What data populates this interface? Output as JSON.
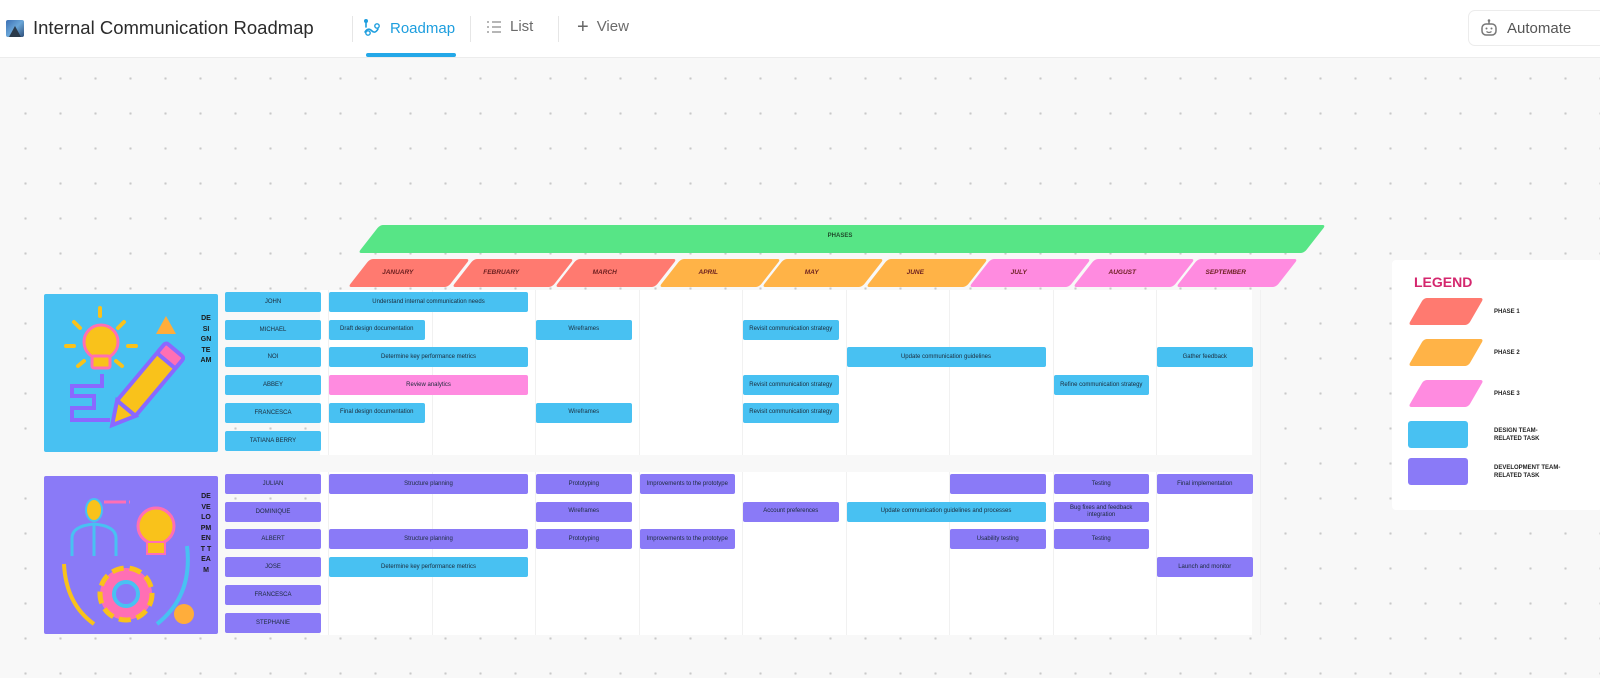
{
  "header": {
    "title": "Internal Communication Roadmap",
    "tabs": [
      {
        "label": "Roadmap",
        "icon": "roadmap-icon",
        "active": true
      },
      {
        "label": "List",
        "icon": "list-icon",
        "active": false
      },
      {
        "label": "View",
        "icon": "plus-icon",
        "active": false
      }
    ],
    "automate_label": "Automate"
  },
  "roadmap": {
    "phases_label": "PHASES",
    "months": [
      {
        "label": "JANUARY",
        "phase": 1
      },
      {
        "label": "FEBRUARY",
        "phase": 1
      },
      {
        "label": "MARCH",
        "phase": 1
      },
      {
        "label": "APRIL",
        "phase": 2
      },
      {
        "label": "MAY",
        "phase": 2
      },
      {
        "label": "JUNE",
        "phase": 2
      },
      {
        "label": "JULY",
        "phase": 3
      },
      {
        "label": "AUGUST",
        "phase": 3
      },
      {
        "label": "SEPTEMBER",
        "phase": 3
      }
    ],
    "colors": {
      "phase1": "#ff7a70",
      "phase2": "#ffb347",
      "phase3": "#ff8be0",
      "phases_header": "#57e586",
      "design_task": "#48c1f2",
      "dev_task": "#8a7af7",
      "legend_title": "#d4276e"
    },
    "teams": [
      {
        "name": "DESIGN TEAM",
        "members": [
          "John",
          "Michael",
          "Noi",
          "Abbey",
          "Francesca",
          "Tatiana Berry"
        ],
        "tasks": [
          {
            "member": 0,
            "start": 0,
            "span": 2,
            "type": "design",
            "label": "Understand internal communication needs"
          },
          {
            "member": 1,
            "start": 0,
            "span": 1,
            "type": "design",
            "label": "Draft design documentation"
          },
          {
            "member": 1,
            "start": 2,
            "span": 1,
            "type": "design",
            "label": "Wireframes"
          },
          {
            "member": 1,
            "start": 4,
            "span": 1,
            "type": "design",
            "label": "Revisit communication strategy"
          },
          {
            "member": 2,
            "start": 0,
            "span": 2,
            "type": "design",
            "label": "Determine key performance metrics"
          },
          {
            "member": 2,
            "start": 5,
            "span": 2,
            "type": "design",
            "label": "Update communication guidelines"
          },
          {
            "member": 2,
            "start": 8,
            "span": 1,
            "type": "design",
            "label": "Gather feedback"
          },
          {
            "member": 3,
            "start": 0,
            "span": 2,
            "type": "pink",
            "label": "Review analytics"
          },
          {
            "member": 3,
            "start": 4,
            "span": 1,
            "type": "design",
            "label": "Revisit communication strategy"
          },
          {
            "member": 3,
            "start": 7,
            "span": 1,
            "type": "design",
            "label": "Refine communication strategy"
          },
          {
            "member": 4,
            "start": 0,
            "span": 1,
            "type": "design",
            "label": "Final design documentation"
          },
          {
            "member": 4,
            "start": 2,
            "span": 1,
            "type": "design",
            "label": "Wireframes"
          },
          {
            "member": 4,
            "start": 4,
            "span": 1,
            "type": "design",
            "label": "Revisit communication strategy"
          }
        ]
      },
      {
        "name": "DEVELOPMENT TEAM",
        "members": [
          "Julian",
          "Dominique",
          "Albert",
          "Jose",
          "Francesca",
          "Stephanie"
        ],
        "tasks": [
          {
            "member": 0,
            "start": 0,
            "span": 2,
            "type": "dev",
            "label": "Structure planning"
          },
          {
            "member": 0,
            "start": 2,
            "span": 1,
            "type": "dev",
            "label": "Prototyping"
          },
          {
            "member": 0,
            "start": 3,
            "span": 1,
            "type": "dev",
            "label": "Improvements to the prototype"
          },
          {
            "member": 0,
            "start": 6,
            "span": 1,
            "type": "dev",
            "label": ""
          },
          {
            "member": 0,
            "start": 7,
            "span": 1,
            "type": "dev",
            "label": "Testing"
          },
          {
            "member": 0,
            "start": 8,
            "span": 1,
            "type": "dev",
            "label": "Final implementation"
          },
          {
            "member": 1,
            "start": 2,
            "span": 1,
            "type": "dev",
            "label": "Wireframes"
          },
          {
            "member": 1,
            "start": 4,
            "span": 1,
            "type": "dev",
            "label": "Account preferences"
          },
          {
            "member": 1,
            "start": 5,
            "span": 2,
            "type": "design",
            "label": "Update communication guidelines and processes"
          },
          {
            "member": 1,
            "start": 7,
            "span": 1,
            "type": "dev",
            "label": "Bug fixes and feedback integration"
          },
          {
            "member": 2,
            "start": 0,
            "span": 2,
            "type": "dev",
            "label": "Structure planning"
          },
          {
            "member": 2,
            "start": 2,
            "span": 1,
            "type": "dev",
            "label": "Prototyping"
          },
          {
            "member": 2,
            "start": 3,
            "span": 1,
            "type": "dev",
            "label": "Improvements to the prototype"
          },
          {
            "member": 2,
            "start": 6,
            "span": 1,
            "type": "dev",
            "label": "Usability testing"
          },
          {
            "member": 2,
            "start": 7,
            "span": 1,
            "type": "dev",
            "label": "Testing"
          },
          {
            "member": 3,
            "start": 0,
            "span": 2,
            "type": "design",
            "label": "Determine key performance metrics"
          },
          {
            "member": 3,
            "start": 8,
            "span": 1,
            "type": "dev",
            "label": "Launch and monitor"
          }
        ]
      }
    ]
  },
  "legend": {
    "title": "LEGEND",
    "items": [
      {
        "label": "PHASE 1",
        "color": "#ff7a70",
        "shape": "parallelogram"
      },
      {
        "label": "PHASE 2",
        "color": "#ffb347",
        "shape": "parallelogram"
      },
      {
        "label": "PHASE 3",
        "color": "#ff8be0",
        "shape": "parallelogram"
      },
      {
        "label": "DESIGN TEAM-RELATED TASK",
        "color": "#48c1f2",
        "shape": "rectangle"
      },
      {
        "label": "DEVELOPMENT TEAM-RELATED TASK",
        "color": "#8a7af7",
        "shape": "rectangle"
      }
    ]
  }
}
